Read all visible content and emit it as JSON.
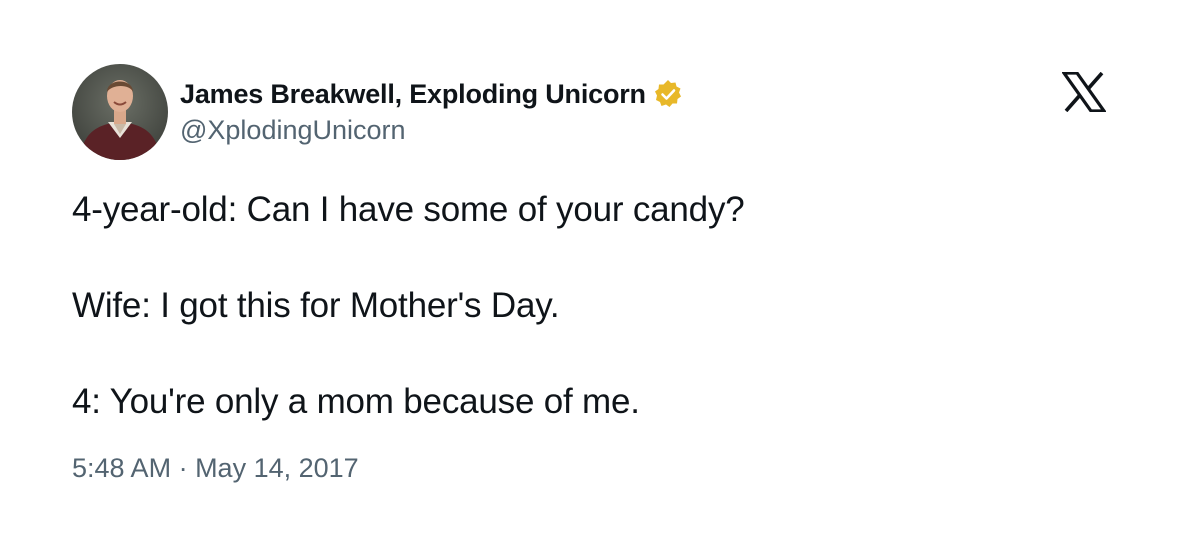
{
  "author": {
    "display_name": "James Breakwell, Exploding Unicorn",
    "handle": "@XplodingUnicorn",
    "verified_badge_color": "#e8b829",
    "avatar_icon": "profile-photo"
  },
  "brand": {
    "logo_icon": "x-logo-icon"
  },
  "tweet": {
    "lines": [
      "4-year-old: Can I have some of your candy?",
      "Wife: I got this for Mother's Day.",
      "4: You're only a mom because of me."
    ]
  },
  "meta": {
    "time": "5:48 AM",
    "separator": " · ",
    "date": "May 14, 2017"
  }
}
